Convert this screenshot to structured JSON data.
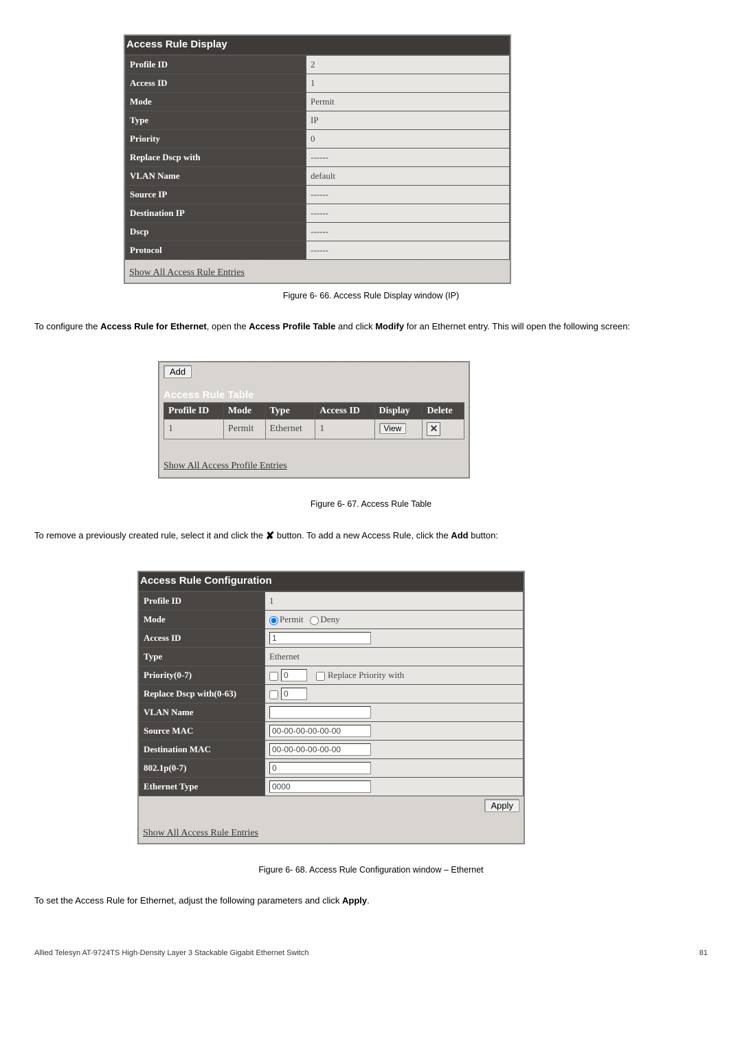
{
  "display": {
    "title": "Access Rule Display",
    "rows": [
      {
        "k": "Profile ID",
        "v": "2"
      },
      {
        "k": "Access ID",
        "v": "1"
      },
      {
        "k": "Mode",
        "v": "Permit"
      },
      {
        "k": "Type",
        "v": "IP"
      },
      {
        "k": "Priority",
        "v": "0"
      },
      {
        "k": "Replace Dscp with",
        "v": "------"
      },
      {
        "k": "VLAN Name",
        "v": "default"
      },
      {
        "k": "Source IP",
        "v": "------"
      },
      {
        "k": "Destination IP",
        "v": "------"
      },
      {
        "k": "Dscp",
        "v": "------"
      },
      {
        "k": "Protocol",
        "v": "------"
      }
    ],
    "show_link": "Show All Access Rule Entries"
  },
  "caption1": "Figure 6- 66. Access Rule Display window (IP)",
  "para1_pre": "To configure the ",
  "para1_b1": "Access Rule for Ethernet",
  "para1_mid": ", open the ",
  "para1_b2": "Access Profile Table",
  "para1_mid2": " and click ",
  "para1_b3": "Modify",
  "para1_post": " for an Ethernet entry. This will open the following screen:",
  "tablepanel": {
    "add_label": "Add",
    "title": "Access Rule Table",
    "headers": [
      "Profile ID",
      "Mode",
      "Type",
      "Access ID",
      "Display",
      "Delete"
    ],
    "row": {
      "profile": "1",
      "mode": "Permit",
      "type": "Ethernet",
      "access": "1",
      "view_label": "View"
    },
    "show_link": "Show All Access Profile Entries"
  },
  "caption2": "Figure 6- 67. Access Rule Table",
  "para2_pre": "To remove a previously created rule, select it and click the ",
  "para2_x": "✘",
  "para2_mid": " button. To add a new Access Rule, click the ",
  "para2_b1": "Add",
  "para2_post": " button:",
  "config": {
    "title": "Access Rule Configuration",
    "profile_id_k": "Profile ID",
    "profile_id_v": "1",
    "mode_k": "Mode",
    "mode_permit": "Permit",
    "mode_deny": "Deny",
    "access_id_k": "Access ID",
    "access_id_v": "1",
    "type_k": "Type",
    "type_v": "Ethernet",
    "priority_k": "Priority(0-7)",
    "priority_v": "0",
    "priority_replace": "Replace Priority with",
    "dscp_k": "Replace Dscp with(0-63)",
    "dscp_v": "0",
    "vlan_k": "VLAN Name",
    "vlan_v": "",
    "smac_k": "Source MAC",
    "smac_v": "00-00-00-00-00-00",
    "dmac_k": "Destination MAC",
    "dmac_v": "00-00-00-00-00-00",
    "e8021p_k": "802.1p(0-7)",
    "e8021p_v": "0",
    "etype_k": "Ethernet Type",
    "etype_v": "0000",
    "apply_label": "Apply",
    "show_link": "Show All Access Rule Entries"
  },
  "caption3": "Figure 6- 68. Access Rule Configuration window – Ethernet",
  "para3_pre": "To set the Access Rule for Ethernet, adjust the following parameters and click ",
  "para3_b1": "Apply",
  "para3_post": ".",
  "footer_left": "Allied Telesyn AT-9724TS High-Density Layer 3 Stackable Gigabit Ethernet Switch",
  "footer_right": "81"
}
